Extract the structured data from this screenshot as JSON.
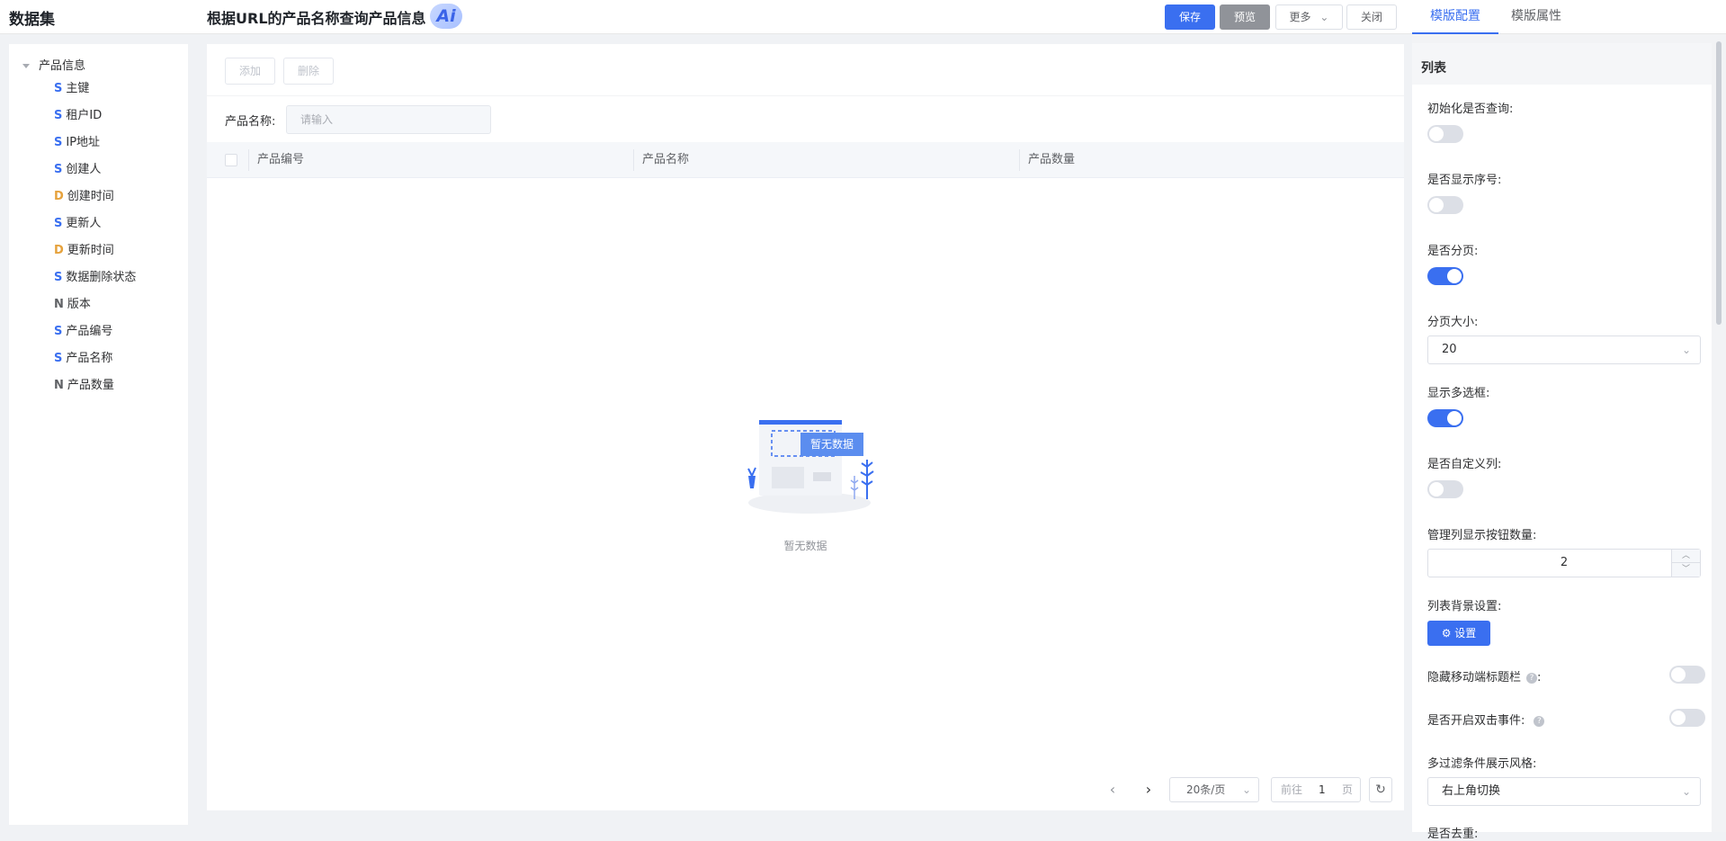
{
  "header": {
    "brand": "数据集",
    "title": "根据URL的产品名称查询产品信息",
    "ai_label": "Ai",
    "save_label": "保存",
    "preview_label": "预览",
    "more_label": "更多",
    "close_label": "关闭",
    "tabs": [
      {
        "label": "模版配置",
        "active": true
      },
      {
        "label": "模版属性",
        "active": false
      }
    ]
  },
  "tree": {
    "root": "产品信息",
    "items": [
      {
        "type": "S",
        "label": "主键"
      },
      {
        "type": "S",
        "label": "租户ID"
      },
      {
        "type": "S",
        "label": "IP地址"
      },
      {
        "type": "S",
        "label": "创建人"
      },
      {
        "type": "D",
        "label": "创建时间"
      },
      {
        "type": "S",
        "label": "更新人"
      },
      {
        "type": "D",
        "label": "更新时间"
      },
      {
        "type": "S",
        "label": "数据删除状态"
      },
      {
        "type": "N",
        "label": "版本"
      },
      {
        "type": "S",
        "label": "产品编号"
      },
      {
        "type": "S",
        "label": "产品名称"
      },
      {
        "type": "N",
        "label": "产品数量"
      }
    ]
  },
  "toolbar": {
    "add_label": "添加",
    "delete_label": "删除"
  },
  "filter": {
    "label": "产品名称:",
    "placeholder": "请输入"
  },
  "table": {
    "columns": [
      "产品编号",
      "产品名称",
      "产品数量"
    ],
    "empty_badge": "暂无数据",
    "empty_text": "暂无数据"
  },
  "pagination": {
    "page_size": "20条/页",
    "goto_prefix": "前往",
    "current_page": "1",
    "goto_suffix": "页"
  },
  "right_panel": {
    "section_title": "列表",
    "settings": {
      "init_query_label": "初始化是否查询:",
      "init_query_on": false,
      "show_index_label": "是否显示序号:",
      "show_index_on": false,
      "paginate_label": "是否分页:",
      "paginate_on": true,
      "page_size_label": "分页大小:",
      "page_size_value": "20",
      "multi_select_label": "显示多选框:",
      "multi_select_on": true,
      "custom_columns_label": "是否自定义列:",
      "custom_columns_on": false,
      "manage_btn_count_label": "管理列显示按钮数量:",
      "manage_btn_count_value": "2",
      "bg_setting_label": "列表背景设置:",
      "bg_setting_button": "设置",
      "hide_mobile_title_label": "隐藏移动端标题栏",
      "hide_mobile_title_suffix": ":",
      "hide_mobile_title_on": false,
      "dblclick_label": "是否开启双击事件:",
      "dblclick_on": false,
      "filter_style_label": "多过滤条件展示风格:",
      "filter_style_value": "右上角切换",
      "dedupe_label": "是否去重:"
    }
  },
  "colors": {
    "primary": "#3a6ff0",
    "preview_button": "#909399",
    "field_type_S": "#3a6ff0",
    "field_type_D": "#e6a23c",
    "field_type_N": "#606266"
  }
}
